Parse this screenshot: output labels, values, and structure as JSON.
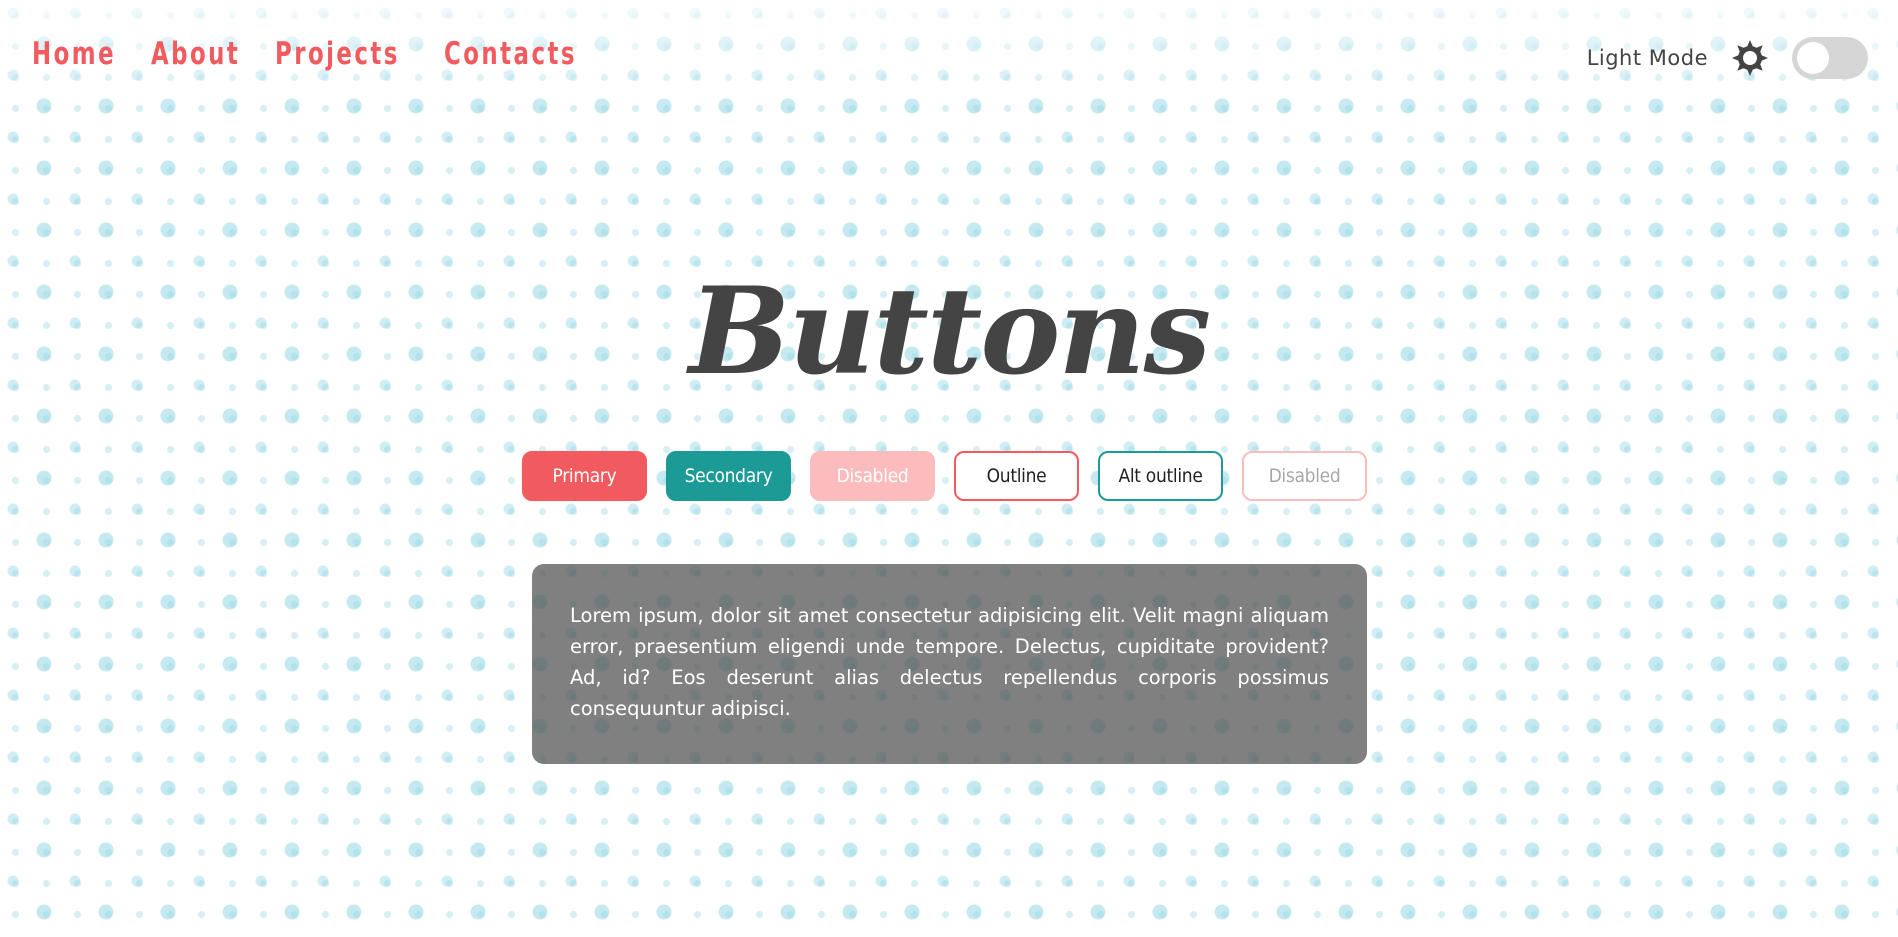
{
  "nav": {
    "items": [
      {
        "label": "Home"
      },
      {
        "label": "About"
      },
      {
        "label": "Projects"
      },
      {
        "label": "Contacts"
      }
    ]
  },
  "theme": {
    "label": "Light Mode",
    "icon": "sun-icon",
    "toggle_state": "off"
  },
  "main": {
    "title": "Buttons",
    "buttons": [
      {
        "label": "Primary",
        "variant": "primary"
      },
      {
        "label": "Secondary",
        "variant": "secondary"
      },
      {
        "label": "Disabled",
        "variant": "disabled"
      },
      {
        "label": "Outline",
        "variant": "outline"
      },
      {
        "label": "Alt outline",
        "variant": "alt-outline"
      },
      {
        "label": "Disabled",
        "variant": "disabled-outline"
      }
    ],
    "paragraph": "Lorem ipsum, dolor sit amet consectetur adipisicing elit. Velit magni aliquam error, praesentium eligendi unde tempore. Delectus, cupiditate provident? Ad, id? Eos deserunt alias delectus repellendus corporis possimus consequuntur adipisci."
  },
  "colors": {
    "accent": "#f15a5e",
    "secondary": "#1b9a96",
    "disabled": "#fbbcbd",
    "text_dark": "#444444",
    "panel": "#555555",
    "dots": "#96d7e4"
  }
}
